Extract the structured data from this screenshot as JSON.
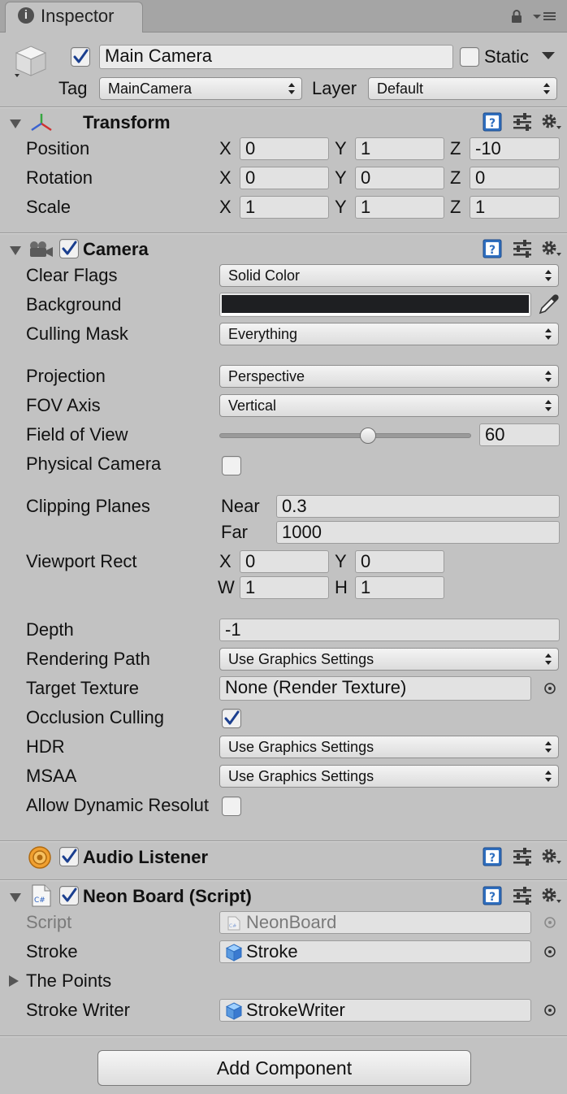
{
  "tab": {
    "icon": "info-icon",
    "label": "Inspector"
  },
  "header": {
    "active": true,
    "name": "Main Camera",
    "static_label": "Static",
    "static": false,
    "tag_label": "Tag",
    "tag_value": "MainCamera",
    "layer_label": "Layer",
    "layer_value": "Default"
  },
  "transform": {
    "title": "Transform",
    "position_label": "Position",
    "rotation_label": "Rotation",
    "scale_label": "Scale",
    "axes": [
      "X",
      "Y",
      "Z"
    ],
    "position": [
      "0",
      "1",
      "-10"
    ],
    "rotation": [
      "0",
      "0",
      "0"
    ],
    "scale": [
      "1",
      "1",
      "1"
    ]
  },
  "camera": {
    "title": "Camera",
    "enabled": true,
    "clear_flags_label": "Clear Flags",
    "clear_flags": "Solid Color",
    "background_label": "Background",
    "background_color": "#1e1f22",
    "culling_mask_label": "Culling Mask",
    "culling_mask": "Everything",
    "projection_label": "Projection",
    "projection": "Perspective",
    "fov_axis_label": "FOV Axis",
    "fov_axis": "Vertical",
    "fov_label": "Field of View",
    "fov": "60",
    "fov_fraction": 0.59,
    "physical_label": "Physical Camera",
    "physical": false,
    "clipping_label": "Clipping Planes",
    "near_label": "Near",
    "near": "0.3",
    "far_label": "Far",
    "far": "1000",
    "viewport_label": "Viewport Rect",
    "vp_x_label": "X",
    "vp_x": "0",
    "vp_y_label": "Y",
    "vp_y": "0",
    "vp_w_label": "W",
    "vp_w": "1",
    "vp_h_label": "H",
    "vp_h": "1",
    "depth_label": "Depth",
    "depth": "-1",
    "rendering_path_label": "Rendering Path",
    "rendering_path": "Use Graphics Settings",
    "target_texture_label": "Target Texture",
    "target_texture": "None (Render Texture)",
    "occlusion_label": "Occlusion Culling",
    "occlusion": true,
    "hdr_label": "HDR",
    "hdr": "Use Graphics Settings",
    "msaa_label": "MSAA",
    "msaa": "Use Graphics Settings",
    "dynamic_res_label": "Allow Dynamic Resolut",
    "dynamic_res": false
  },
  "audio_listener": {
    "title": "Audio Listener",
    "enabled": true
  },
  "neon_board": {
    "title": "Neon Board (Script)",
    "enabled": true,
    "script_label": "Script",
    "script_value": "NeonBoard",
    "stroke_label": "Stroke",
    "stroke_value": "Stroke",
    "points_label": "The Points",
    "stroke_writer_label": "Stroke Writer",
    "stroke_writer_value": "StrokeWriter"
  },
  "add_component_label": "Add Component"
}
